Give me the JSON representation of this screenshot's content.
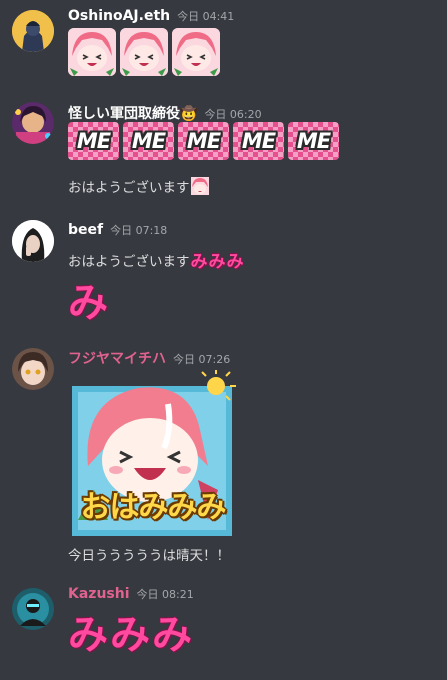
{
  "messages": [
    {
      "username": "OshinoAJ.eth",
      "timestamp": "今日 04:41",
      "name_color": "#ffffff",
      "emotes": [
        "anime-laugh-emote",
        "anime-laugh-emote",
        "anime-laugh-emote"
      ]
    },
    {
      "username": "怪しい軍団取締役🤠",
      "timestamp": "今日 06:20",
      "name_color": "#ffffff",
      "me_emotes": [
        "ME",
        "ME",
        "ME",
        "ME",
        "ME"
      ],
      "text": "おはようございます"
    },
    {
      "username": "beef",
      "timestamp": "今日 07:18",
      "name_color": "#ffffff",
      "text": "おはようございます",
      "inline_emote": "みみみ",
      "big_emote": "み"
    },
    {
      "username": "フジヤマイチハ",
      "timestamp": "今日 07:26",
      "name_color": "#e0628e",
      "sticker_text": "おはみみみ",
      "text": "今日うううううは晴天！！"
    },
    {
      "username": "Kazushi",
      "timestamp": "今日 08:21",
      "name_color": "#e0628e",
      "big_emote": "みみみ"
    }
  ],
  "colors": {
    "background": "#36393f",
    "text": "#dcddde",
    "timestamp": "#a3a6aa",
    "accent_pink": "#ff4aa0"
  }
}
